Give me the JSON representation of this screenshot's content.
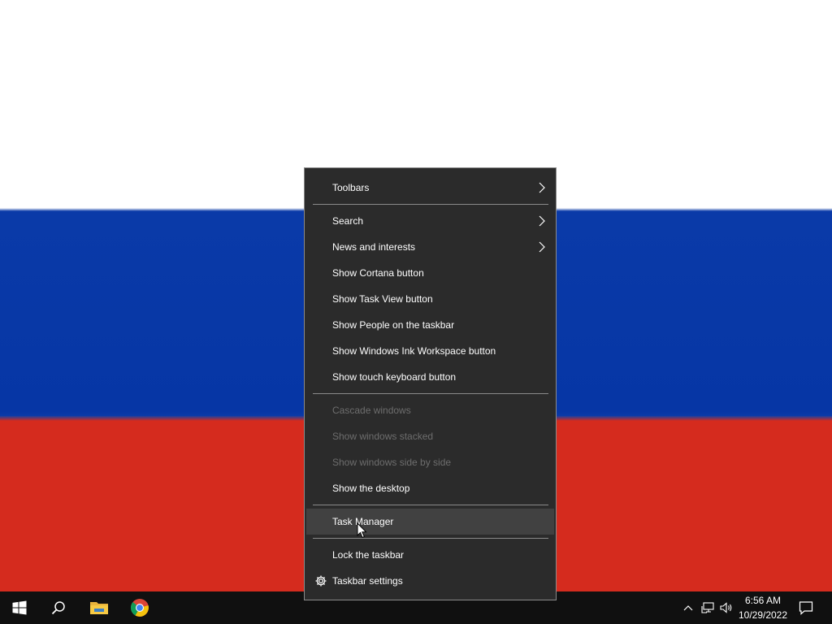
{
  "wallpaper": {
    "colors": [
      "#ffffff",
      "#0636a5",
      "#d52b1e"
    ]
  },
  "context_menu": {
    "items": [
      {
        "label": "Toolbars",
        "submenu": true,
        "enabled": true
      },
      {
        "label": "Search",
        "submenu": true,
        "enabled": true
      },
      {
        "label": "News and interests",
        "submenu": true,
        "enabled": true
      },
      {
        "label": "Show Cortana button",
        "enabled": true
      },
      {
        "label": "Show Task View button",
        "enabled": true
      },
      {
        "label": "Show People on the taskbar",
        "enabled": true
      },
      {
        "label": "Show Windows Ink Workspace button",
        "enabled": true
      },
      {
        "label": "Show touch keyboard button",
        "enabled": true
      },
      {
        "label": "Cascade windows",
        "enabled": false
      },
      {
        "label": "Show windows stacked",
        "enabled": false
      },
      {
        "label": "Show windows side by side",
        "enabled": false
      },
      {
        "label": "Show the desktop",
        "enabled": true
      },
      {
        "label": "Task Manager",
        "enabled": true,
        "hovered": true
      },
      {
        "label": "Lock the taskbar",
        "enabled": true
      },
      {
        "label": "Taskbar settings",
        "enabled": true,
        "icon": "gear-icon"
      }
    ]
  },
  "taskbar": {
    "pinned": [
      {
        "name": "start",
        "icon": "windows-logo-icon"
      },
      {
        "name": "search",
        "icon": "search-icon"
      },
      {
        "name": "file-explorer",
        "icon": "folder-icon"
      },
      {
        "name": "chrome",
        "icon": "chrome-icon"
      }
    ],
    "tray": {
      "icons": [
        "chevron-up-icon",
        "network-icon",
        "volume-icon"
      ],
      "time": "6:56 AM",
      "date": "10/29/2022",
      "notification_icon": "action-center-icon"
    }
  },
  "colors": {
    "menu_bg": "#2b2b2b",
    "menu_hover": "#414141",
    "menu_disabled_text": "#6d6d6d",
    "taskbar_bg": "#101010"
  }
}
